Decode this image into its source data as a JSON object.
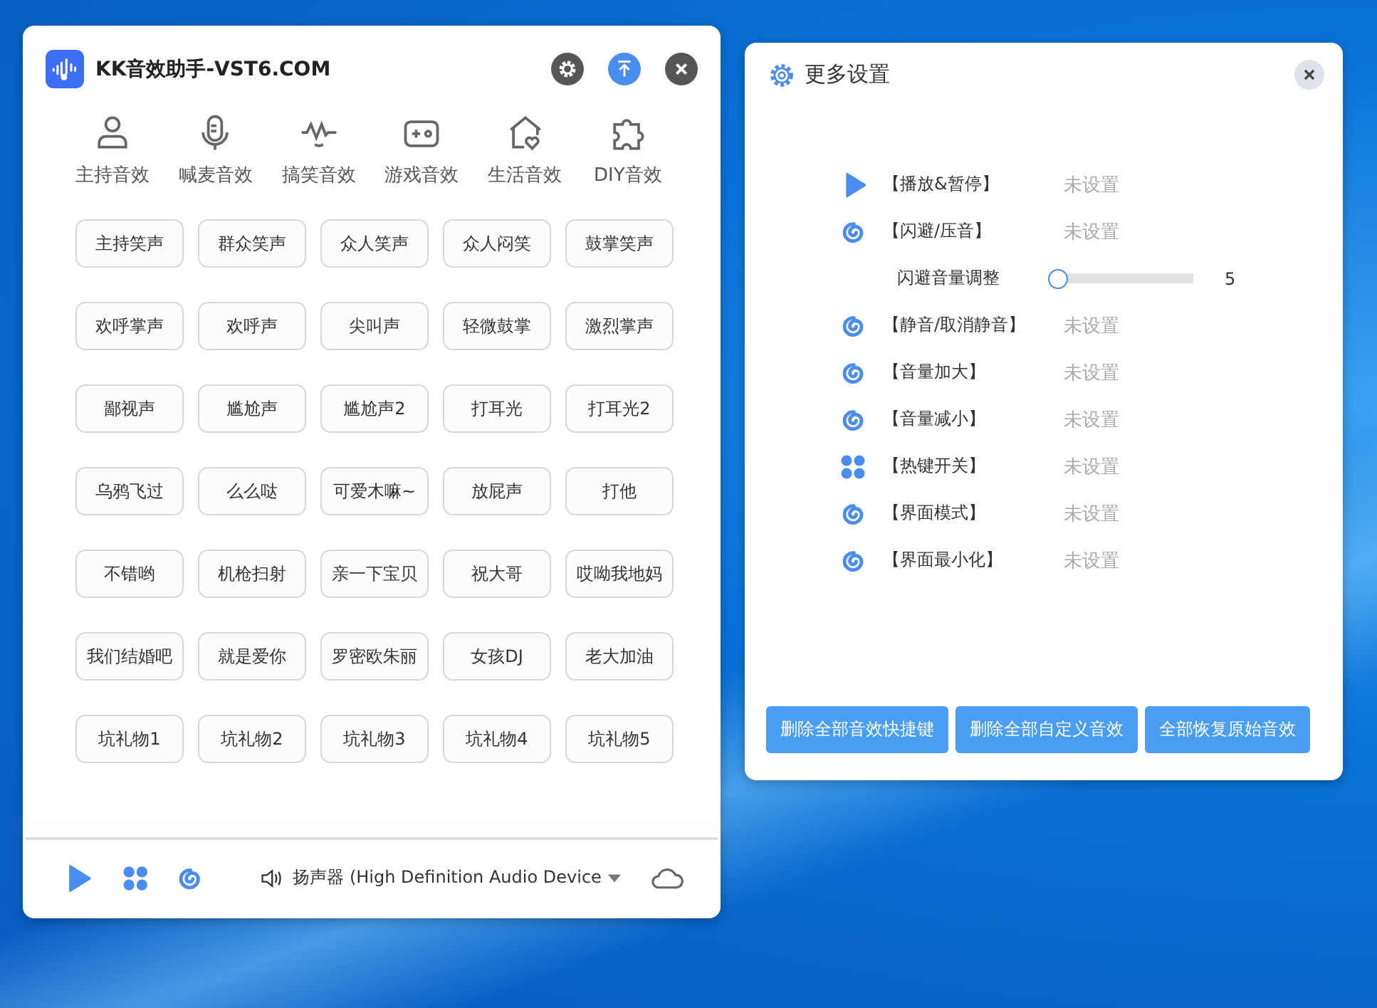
{
  "main_window": {
    "title": "KK音效助手-VST6.COM",
    "categories": [
      {
        "label": "主持音效",
        "kind": "person"
      },
      {
        "label": "喊麦音效",
        "kind": "mic"
      },
      {
        "label": "搞笑音效",
        "kind": "wave"
      },
      {
        "label": "游戏音效",
        "kind": "gamepad"
      },
      {
        "label": "生活音效",
        "kind": "house"
      },
      {
        "label": "DIY音效",
        "kind": "puzzle"
      }
    ],
    "sound_buttons": [
      "主持笑声",
      "群众笑声",
      "众人笑声",
      "众人闷笑",
      "鼓掌笑声",
      "欢呼掌声",
      "欢呼声",
      "尖叫声",
      "轻微鼓掌",
      "激烈掌声",
      "鄙视声",
      "尴尬声",
      "尴尬声2",
      "打耳光",
      "打耳光2",
      "乌鸦飞过",
      "么么哒",
      "可爱木嘛~",
      "放屁声",
      "打他",
      "不错哟",
      "机枪扫射",
      "亲一下宝贝",
      "祝大哥",
      "哎呦我地妈",
      "我们结婚吧",
      "就是爱你",
      "罗密欧朱丽",
      "女孩DJ",
      "老大加油",
      "坑礼物1",
      "坑礼物2",
      "坑礼物3",
      "坑礼物4",
      "坑礼物5"
    ],
    "status_bar": {
      "device": "扬声器 (High Definition Audio Device"
    }
  },
  "settings_window": {
    "title": "更多设置",
    "rows": [
      {
        "kind": "play",
        "label": "【播放&暂停】",
        "value": "未设置"
      },
      {
        "kind": "swirl",
        "label": "【闪避/压音】",
        "value": "未设置"
      },
      {
        "kind": "slider",
        "label": "闪避音量调整",
        "level": 0,
        "reading": "5"
      },
      {
        "kind": "swirl",
        "label": "【静音/取消静音】",
        "value": "未设置"
      },
      {
        "kind": "swirl",
        "label": "【音量加大】",
        "value": "未设置"
      },
      {
        "kind": "swirl",
        "label": "【音量减小】",
        "value": "未设置"
      },
      {
        "kind": "grid",
        "label": "【热键开关】",
        "value": "未设置"
      },
      {
        "kind": "swirl",
        "label": "【界面模式】",
        "value": "未设置"
      },
      {
        "kind": "swirl",
        "label": "【界面最小化】",
        "value": "未设置"
      }
    ],
    "buttons": [
      "删除全部音效快捷键",
      "删除全部自定义音效",
      "全部恢复原始音效"
    ]
  }
}
